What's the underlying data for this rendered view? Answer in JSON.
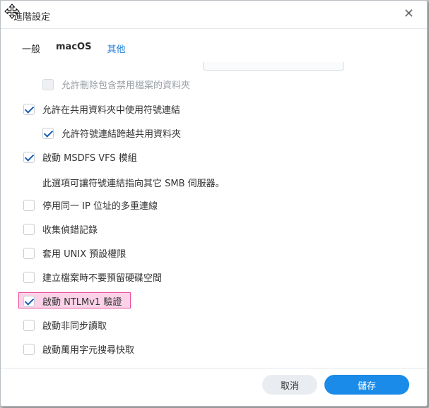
{
  "dialog": {
    "title": "進階設定",
    "close_glyph": "✕"
  },
  "tabs": [
    {
      "label": "一般",
      "active": false
    },
    {
      "label": "macOS",
      "active": false
    },
    {
      "label": "其他",
      "active": true
    }
  ],
  "options": [
    {
      "label": "允許刪除包含禁用檔案的資料夾",
      "checked": false,
      "disabled": true
    },
    {
      "label": "允許在共用資料夾中使用符號連結",
      "checked": true
    },
    {
      "label": "允許符號連結跨越共用資料夾",
      "checked": true
    },
    {
      "label": "啟動 MSDFS VFS 模組",
      "checked": true
    },
    {
      "label": "停用同一 IP 位址的多重連線",
      "checked": false
    },
    {
      "label": "收集偵錯記錄",
      "checked": false
    },
    {
      "label": "套用 UNIX 預設權限",
      "checked": false
    },
    {
      "label": "建立檔案時不要預留硬碟空間",
      "checked": false
    },
    {
      "label": "啟動 NTLMv1 驗證",
      "checked": true,
      "highlighted": true
    },
    {
      "label": "啟動非同步讀取",
      "checked": false
    },
    {
      "label": "啟動萬用字元搜尋快取",
      "checked": false
    }
  ],
  "msdfs_note": "此選項可讓符號連結指向其它 SMB 伺服器。",
  "buttons": {
    "cancel": "取消",
    "save": "儲存"
  },
  "colors": {
    "accent": "#1a8be8",
    "highlight_border": "#ea4d9a",
    "highlight_fill": "#fbd2e8"
  }
}
